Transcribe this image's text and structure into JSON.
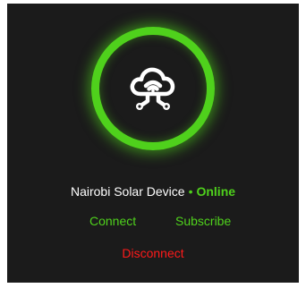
{
  "device": {
    "name": "Nairobi Solar Device",
    "separator": "•",
    "status": "Online",
    "icon": "cloud-network-icon"
  },
  "actions": {
    "connect_label": "Connect",
    "subscribe_label": "Subscribe",
    "disconnect_label": "Disconnect"
  },
  "colors": {
    "background": "#1b1b1b",
    "accent": "#4fd11c",
    "danger": "#ff1a1a",
    "text": "#ffffff"
  }
}
